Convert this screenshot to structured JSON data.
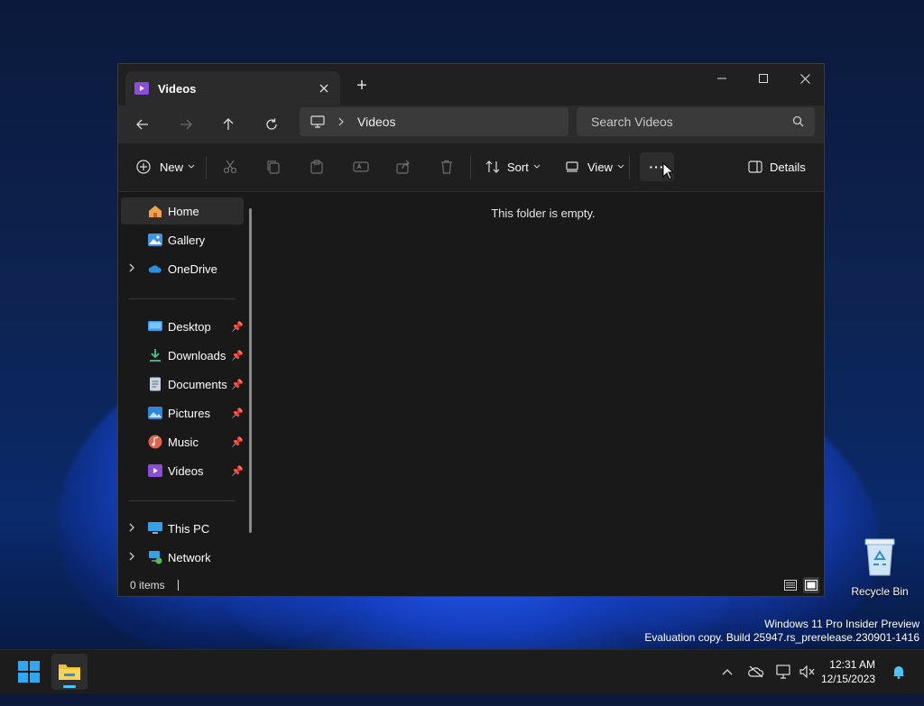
{
  "window": {
    "tab_title": "Videos",
    "new_tab": "+",
    "controls": {
      "minimize": "—",
      "maximize": "☐",
      "close": "✕"
    }
  },
  "nav": {
    "breadcrumb": "Videos",
    "search_placeholder": "Search Videos"
  },
  "toolbar": {
    "new_label": "New",
    "sort_label": "Sort",
    "view_label": "View",
    "more_label": "···",
    "details_label": "Details"
  },
  "sidebar": {
    "top_items": [
      {
        "label": "Home",
        "icon": "home-icon"
      },
      {
        "label": "Gallery",
        "icon": "gallery-icon"
      },
      {
        "label": "OneDrive",
        "icon": "onedrive-icon"
      }
    ],
    "pinned_items": [
      {
        "label": "Desktop",
        "icon": "desktop-folder-icon"
      },
      {
        "label": "Downloads",
        "icon": "downloads-icon"
      },
      {
        "label": "Documents",
        "icon": "documents-icon"
      },
      {
        "label": "Pictures",
        "icon": "pictures-icon"
      },
      {
        "label": "Music",
        "icon": "music-icon"
      },
      {
        "label": "Videos",
        "icon": "videos-icon"
      }
    ],
    "bottom_items": [
      {
        "label": "This PC",
        "icon": "this-pc-icon"
      },
      {
        "label": "Network",
        "icon": "network-icon"
      }
    ]
  },
  "content": {
    "empty_message": "This folder is empty."
  },
  "status": {
    "item_count": "0 items"
  },
  "desktop": {
    "recycle_bin": "Recycle Bin",
    "watermark_line1": "Windows 11 Pro Insider Preview",
    "watermark_line2": "Evaluation copy. Build 25947.rs_prerelease.230901-1416"
  },
  "taskbar": {
    "time": "12:31 AM",
    "date": "12/15/2023"
  },
  "colors": {
    "accent": "#4cc2ff",
    "videos_purple": "#8a4dd8",
    "folder_yellow": "#f3c02e"
  }
}
